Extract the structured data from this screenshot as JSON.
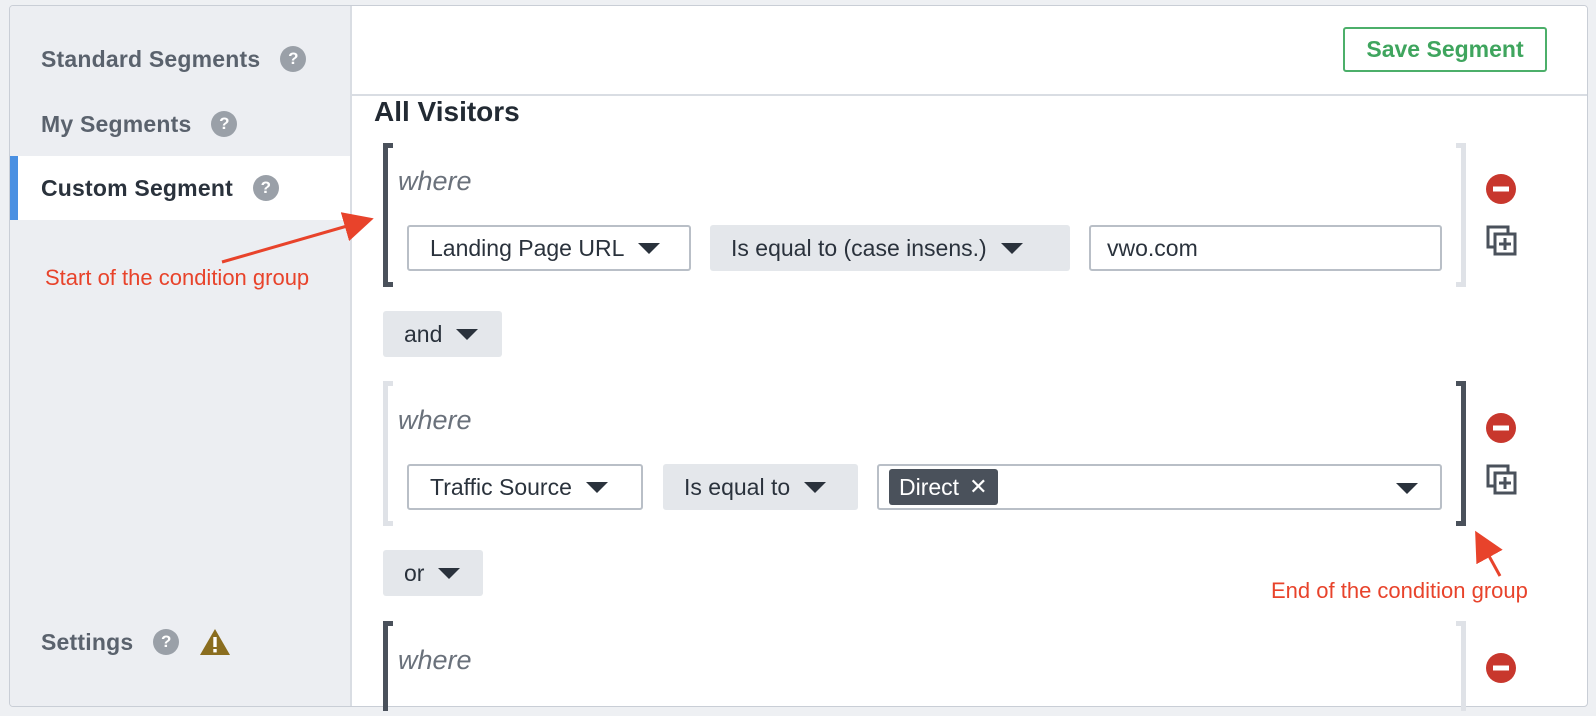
{
  "sidebar": {
    "items": [
      {
        "label": "Standard Segments",
        "help": "?"
      },
      {
        "label": "My Segments",
        "help": "?"
      },
      {
        "label": "Custom Segment",
        "help": "?"
      }
    ],
    "settings_label": "Settings",
    "settings_help": "?"
  },
  "toolbar": {
    "save_label": "Save Segment"
  },
  "main": {
    "title": "All Visitors",
    "groups": [
      {
        "where": "where",
        "field": "Landing Page URL",
        "operator": "Is equal to (case insens.)",
        "value": "vwo.com"
      },
      {
        "where": "where",
        "field": "Traffic Source",
        "operator": "Is equal to",
        "value_chip": "Direct",
        "chip_remove": "✕"
      },
      {
        "where": "where"
      }
    ],
    "connectors": [
      "and",
      "or"
    ]
  },
  "annotations": {
    "start": "Start of the condition group",
    "end": "End of the condition group"
  },
  "colors": {
    "accent": "#4a90e2",
    "save": "#3fa55e",
    "remove": "#c8372d",
    "annotation": "#e8432b",
    "warning": "#8a6d1f"
  },
  "icons": [
    "help-icon",
    "warning-icon",
    "remove-circle-icon",
    "duplicate-icon",
    "caret-down-icon",
    "close-icon"
  ]
}
